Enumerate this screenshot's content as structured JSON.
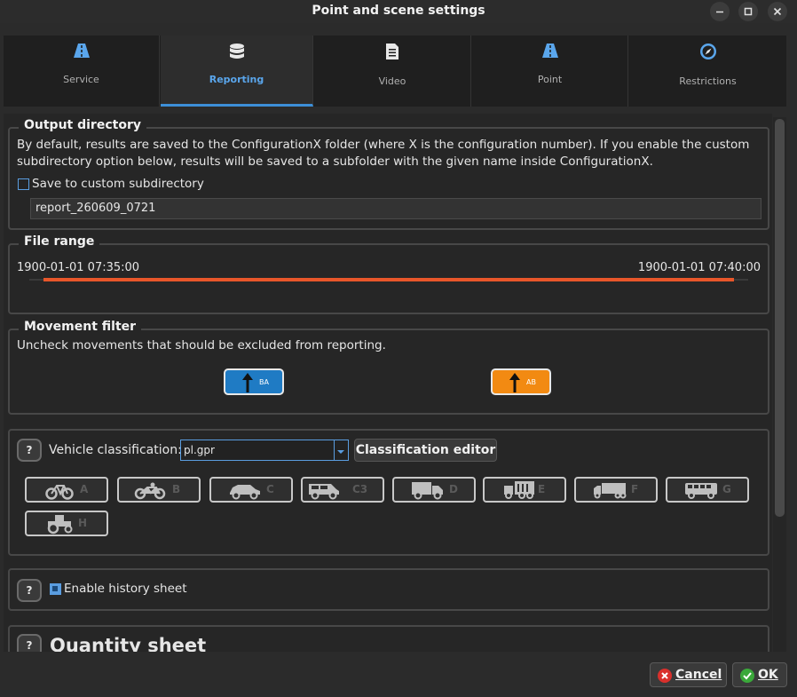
{
  "window": {
    "title": "Point and scene settings"
  },
  "tabs": [
    {
      "label": "Service",
      "icon": "road-icon"
    },
    {
      "label": "Reporting",
      "icon": "database-icon",
      "active": true
    },
    {
      "label": "Video",
      "icon": "document-icon"
    },
    {
      "label": "Point",
      "icon": "road-icon"
    },
    {
      "label": "Restrictions",
      "icon": "compass-icon"
    }
  ],
  "output_directory": {
    "title": "Output directory",
    "description_line1": "By default, results are saved to the ConfigurationX folder (where X is the configuration number). If you enable the custom",
    "description_line2": "subdirectory option below, results will be saved to a subfolder with the given name inside ConfigurationX.",
    "checkbox_label": "Save to custom subdirectory",
    "checkbox_checked": false,
    "subdirectory_value": "report_260609_0721"
  },
  "file_range": {
    "title": "File range",
    "start": "1900-01-01 07:35:00",
    "end": "1900-01-01 07:40:00",
    "bar_color": "#e8562a"
  },
  "movement_filter": {
    "title": "Movement filter",
    "description": "Uncheck movements that should be excluded from reporting.",
    "movements": [
      {
        "label": "BA",
        "color": "#1f7bc4"
      },
      {
        "label": "AB",
        "color": "#f28a12"
      }
    ]
  },
  "vehicle_classification": {
    "help_label": "?",
    "label": "Vehicle classification:",
    "selected": "pl.gpr",
    "editor_button": "Classification editor",
    "classes": [
      {
        "label": "A",
        "icon": "bicycle-icon"
      },
      {
        "label": "B",
        "icon": "motorcycle-icon"
      },
      {
        "label": "C",
        "icon": "car-icon"
      },
      {
        "label": "C3",
        "icon": "van-icon"
      },
      {
        "label": "D",
        "icon": "truck-icon"
      },
      {
        "label": "E",
        "icon": "truck-trailer-icon"
      },
      {
        "label": "F",
        "icon": "semi-truck-icon"
      },
      {
        "label": "G",
        "icon": "bus-icon"
      },
      {
        "label": "H",
        "icon": "tractor-icon"
      }
    ]
  },
  "history_sheet": {
    "help_label": "?",
    "label": "Enable history sheet",
    "checked": true
  },
  "quantity_sheet": {
    "help_label": "?",
    "title": "Quantity sheet"
  },
  "footer": {
    "cancel_label": "Cancel",
    "ok_label": "OK"
  },
  "colors": {
    "accent": "#3d8fd8",
    "background": "#262626",
    "border": "#484848"
  }
}
